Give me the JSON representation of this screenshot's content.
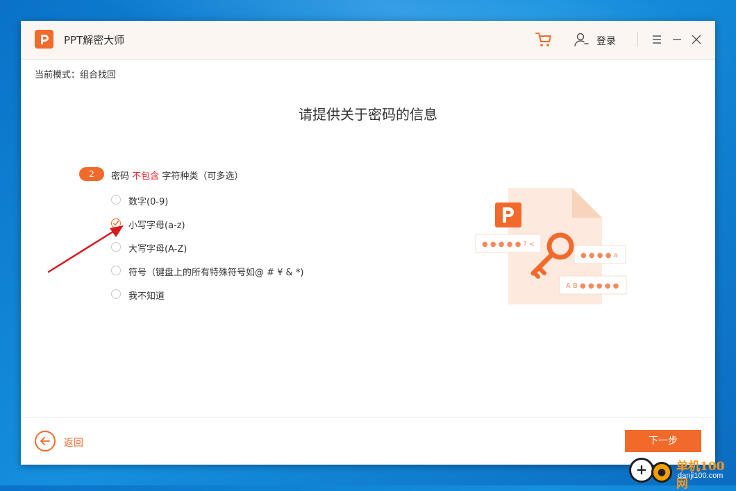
{
  "app": {
    "title": "PPT解密大师",
    "login_label": "登录"
  },
  "mode_text": "当前模式：组合找回",
  "heading": "请提供关于密码的信息",
  "step": {
    "number": "2",
    "prefix": "密码",
    "highlight": "不包含",
    "suffix": "字符种类（可多选）"
  },
  "options": [
    {
      "label": "数字(0-9)",
      "checked": false
    },
    {
      "label": "小写字母(a-z)",
      "checked": true
    },
    {
      "label": "大写字母(A-Z)",
      "checked": false
    },
    {
      "label": "符号（键盘上的所有特殊符号如@ # ¥ & *)",
      "checked": false
    },
    {
      "label": "我不知道",
      "checked": false
    }
  ],
  "illustration": {
    "chip1": "● ● ● ● ● ? <",
    "chip2": "● ● ● ● a",
    "chip3": "A B ● ● ● ● ●"
  },
  "footer": {
    "back_label": "返回",
    "next_label": "下一步"
  },
  "watermark": {
    "title": "单机100网",
    "url": "danji100.com"
  },
  "colors": {
    "accent": "#f26a2b",
    "highlight": "#e5252a",
    "annotation_arrow": "#d71920"
  },
  "icons": [
    "ppt-logo-icon",
    "cart-icon",
    "user-icon",
    "menu-icon",
    "minimize-icon",
    "close-icon",
    "checkmark-icon",
    "back-arrow-icon",
    "key-icon"
  ]
}
